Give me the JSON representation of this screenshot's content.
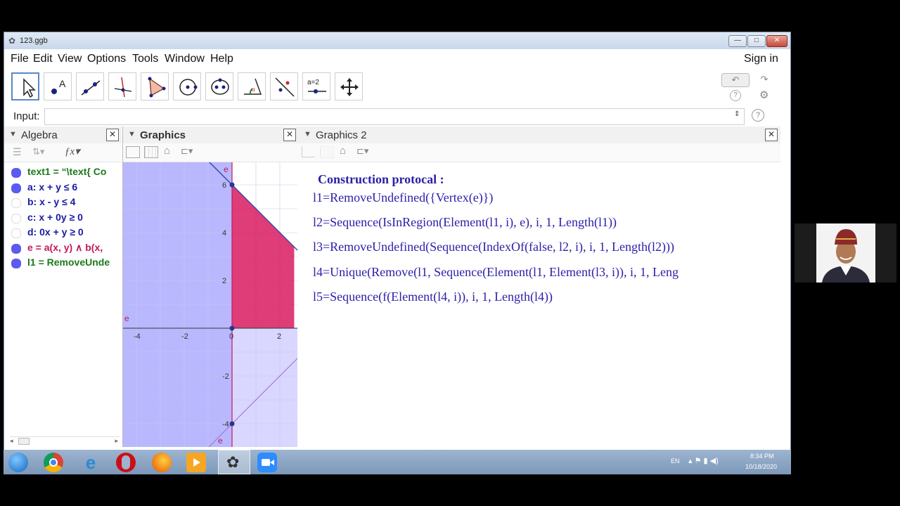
{
  "window": {
    "title": "123.ggb",
    "minimize": "—",
    "maximize": "□",
    "close": "✕"
  },
  "menubar": {
    "items": [
      "File",
      "Edit",
      "View",
      "Options",
      "Tools",
      "Window",
      "Help"
    ],
    "sign_in": "Sign in"
  },
  "toolbar": {
    "tools": [
      "move-tool",
      "point-tool",
      "line-tool",
      "perpendicular-line-tool",
      "polygon-tool",
      "circle-tool",
      "conic-tool",
      "angle-tool",
      "reflect-tool",
      "slider-tool",
      "move-graphics-view-tool"
    ],
    "slider_label": "a=2",
    "undo_icon": "undo-icon",
    "redo_icon": "redo-icon",
    "help_icon": "help-icon",
    "settings_icon": "gear-icon"
  },
  "input_bar": {
    "label": "Input:",
    "value": "",
    "placeholder": ""
  },
  "algebra": {
    "title": "Algebra",
    "items": [
      {
        "text": "text1 = “\\text{ Co",
        "color": "#1a7a1a",
        "dot": "#5b5bef"
      },
      {
        "text": "a: x + y ≤ 6",
        "color": "#1a1aa0",
        "dot": "#5b5bef"
      },
      {
        "text": "b: x - y ≤ 4",
        "color": "#1a1aa0",
        "dot": "#ffffff"
      },
      {
        "text": "c: x + 0y ≥ 0",
        "color": "#1a1aa0",
        "dot": "#ffffff"
      },
      {
        "text": "d: 0x + y ≥ 0",
        "color": "#1a1aa0",
        "dot": "#ffffff"
      },
      {
        "text": "e = a(x, y) ∧ b(x,",
        "color": "#c2185b",
        "dot": "#5b5bef"
      },
      {
        "text": "l1 = RemoveUnde",
        "color": "#1a7a1a",
        "dot": "#5b5bef"
      }
    ]
  },
  "graphics": {
    "title": "Graphics",
    "x_ticks": [
      "-4",
      "-2",
      "0",
      "2"
    ],
    "y_ticks": [
      "6",
      "4",
      "2",
      "-2",
      "-4"
    ],
    "region_label": "e"
  },
  "graphics2": {
    "title": "Graphics 2",
    "heading": "Construction protocal :",
    "lines": [
      "l1=RemoveUndefined({Vertex(e)})",
      "l2=Sequence(IsInRegion(Element(l1, i), e), i, 1, Length(l1))",
      "l3=RemoveUndefined(Sequence(IndexOf(false, l2, i), i, 1, Length(l2)))",
      "l4=Unique(Remove(l1, Sequence(Element(l1, Element(l3, i)), i, 1, Leng",
      "l5=Sequence(f(Element(l4, i)), i, 1, Length(l4))"
    ]
  },
  "taskbar": {
    "apps": [
      "windows-start-icon",
      "chrome-icon",
      "internet-explorer-icon",
      "opera-icon",
      "firefox-icon",
      "media-player-icon",
      "geogebra-icon",
      "zoom-icon"
    ],
    "lang": "EN",
    "time": "8:34 PM",
    "date": "10/18/2020"
  }
}
